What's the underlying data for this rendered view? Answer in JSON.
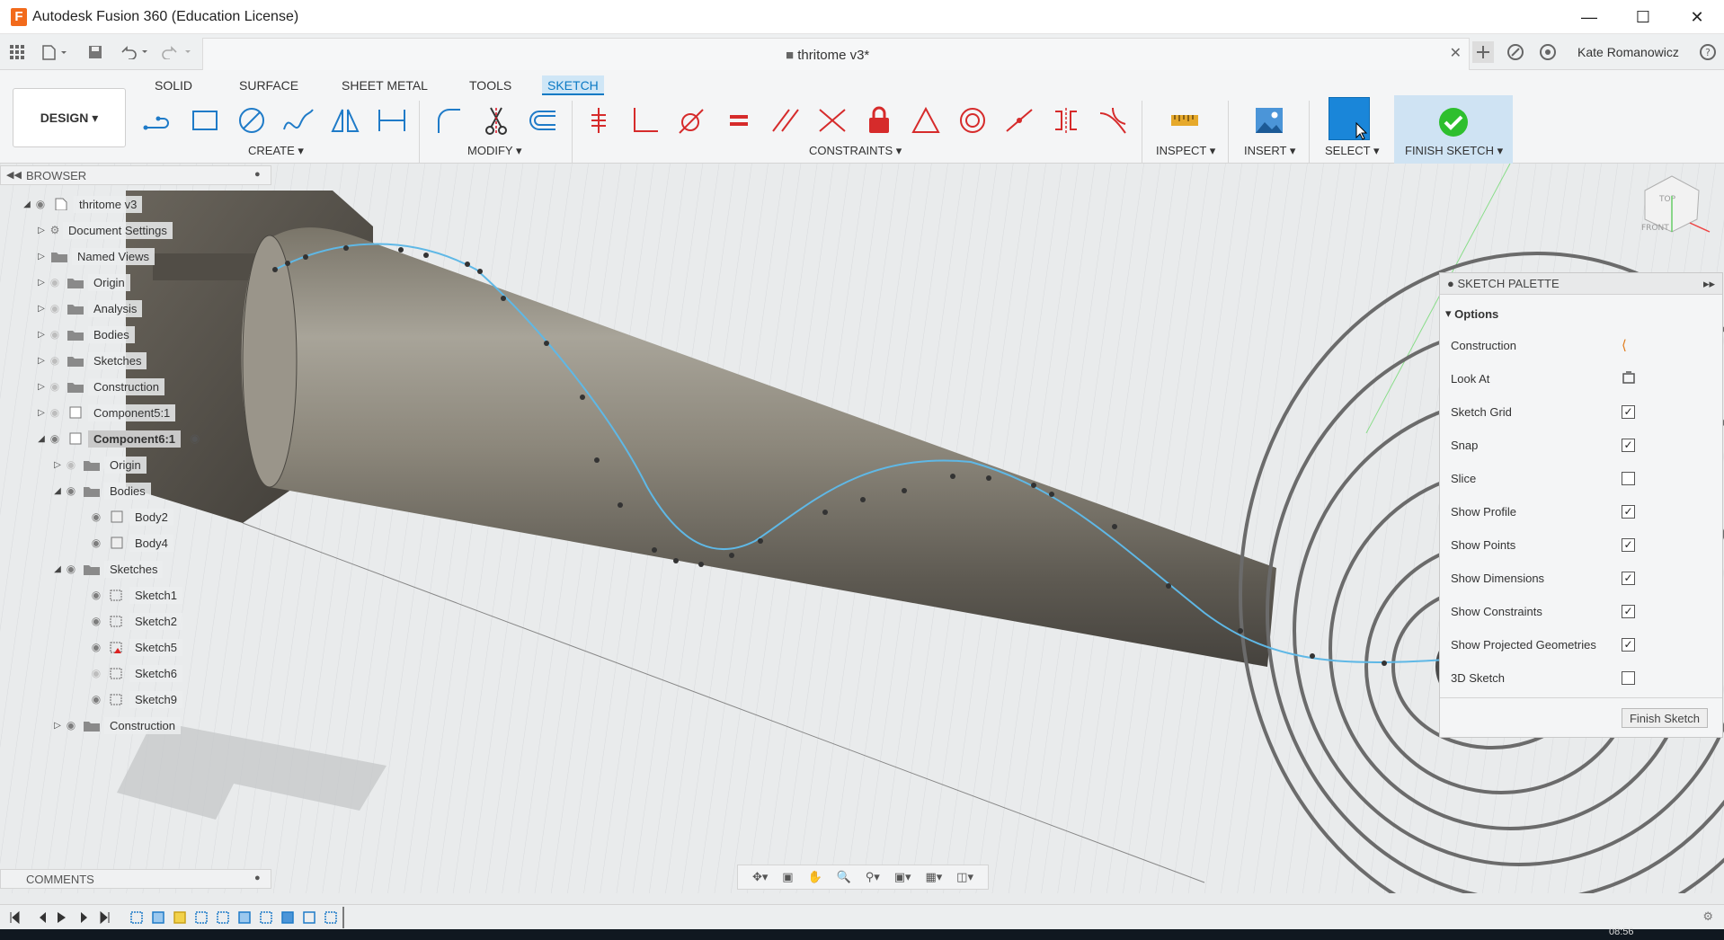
{
  "window": {
    "title": "Autodesk Fusion 360 (Education License)",
    "app_icon_letter": "F"
  },
  "document": {
    "title": "thritome v3*",
    "user": "Kate Romanowicz"
  },
  "ribbon": {
    "workspace": "DESIGN",
    "tabs": [
      "SOLID",
      "SURFACE",
      "SHEET METAL",
      "TOOLS",
      "SKETCH"
    ],
    "active_tab": "SKETCH",
    "groups": {
      "create": "CREATE",
      "modify": "MODIFY",
      "constraints": "CONSTRAINTS",
      "inspect": "INSPECT",
      "insert": "INSERT",
      "select": "SELECT",
      "finish": "FINISH SKETCH"
    },
    "accent": "#0b79c4"
  },
  "browser": {
    "header": "BROWSER",
    "root": "thritome v3",
    "items": {
      "document_settings": "Document Settings",
      "named_views": "Named Views",
      "origin": "Origin",
      "analysis": "Analysis",
      "bodies": "Bodies",
      "sketches": "Sketches",
      "construction": "Construction",
      "component5": "Component5:1",
      "component6": "Component6:1",
      "c6_origin": "Origin",
      "c6_bodies": "Bodies",
      "body2": "Body2",
      "body4": "Body4",
      "c6_sketches": "Sketches",
      "sketch1": "Sketch1",
      "sketch2": "Sketch2",
      "sketch5": "Sketch5",
      "sketch6": "Sketch6",
      "sketch9": "Sketch9",
      "c6_construction": "Construction"
    }
  },
  "palette": {
    "header": "SKETCH PALETTE",
    "section": "Options",
    "rows": {
      "construction": "Construction",
      "look_at": "Look At",
      "sketch_grid": "Sketch Grid",
      "snap": "Snap",
      "slice": "Slice",
      "show_profile": "Show Profile",
      "show_points": "Show Points",
      "show_dimensions": "Show Dimensions",
      "show_constraints": "Show Constraints",
      "show_projected": "Show Projected Geometries",
      "sketch_3d": "3D Sketch"
    },
    "checked": {
      "sketch_grid": true,
      "snap": true,
      "slice": false,
      "show_profile": true,
      "show_points": true,
      "show_dimensions": true,
      "show_constraints": true,
      "show_projected": true,
      "sketch_3d": false
    },
    "finish_button": "Finish Sketch"
  },
  "comments": {
    "header": "COMMENTS"
  },
  "viewcube": {
    "top": "TOP",
    "front": "FRONT"
  },
  "taskbar": {
    "time": "08:56"
  }
}
